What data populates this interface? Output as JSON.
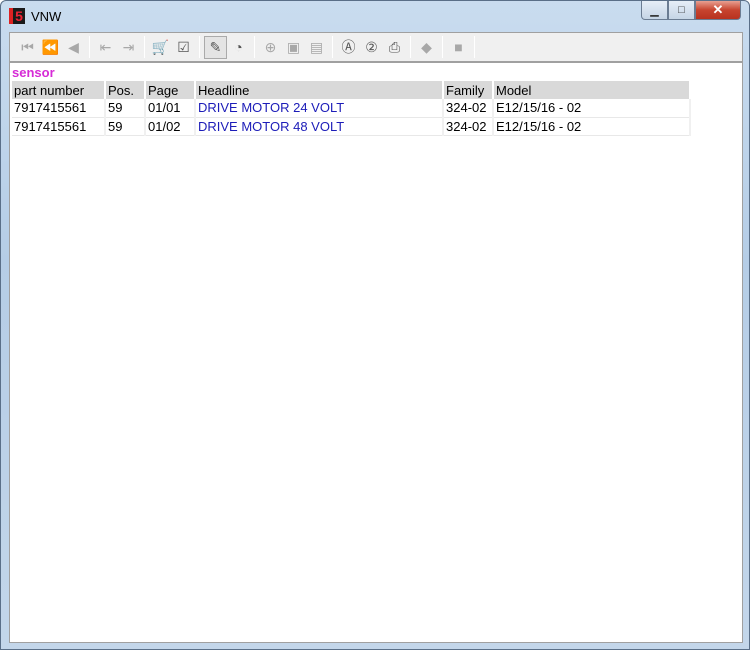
{
  "window": {
    "title": "VNW",
    "minimize": "▁",
    "maximize": "□",
    "close": "✕"
  },
  "toolbar": [
    {
      "name": "first-icon",
      "glyph": "⏮",
      "state": "dis"
    },
    {
      "name": "fast-back-icon",
      "glyph": "⏪",
      "state": "dis"
    },
    {
      "name": "back-icon",
      "glyph": "◀",
      "state": "dis"
    },
    {
      "sep": true
    },
    {
      "name": "prev-doc-icon",
      "glyph": "⇤",
      "state": "dis"
    },
    {
      "name": "next-doc-icon",
      "glyph": "⇥",
      "state": "dis"
    },
    {
      "sep": true
    },
    {
      "name": "cart-icon",
      "glyph": "🛒",
      "state": ""
    },
    {
      "name": "checklist-icon",
      "glyph": "☑",
      "state": ""
    },
    {
      "sep": true
    },
    {
      "name": "tag-icon",
      "glyph": "✎",
      "state": "act"
    },
    {
      "name": "clock-icon",
      "glyph": "◔",
      "state": ""
    },
    {
      "sep": true
    },
    {
      "name": "zoom-in-icon",
      "glyph": "⊕",
      "state": "dis"
    },
    {
      "name": "page-icon",
      "glyph": "▣",
      "state": "dis"
    },
    {
      "name": "page-fold-icon",
      "glyph": "▤",
      "state": "dis"
    },
    {
      "sep": true
    },
    {
      "name": "search-a-icon",
      "glyph": "Ⓐ",
      "state": ""
    },
    {
      "name": "search-2-icon",
      "glyph": "②",
      "state": ""
    },
    {
      "name": "print-icon",
      "glyph": "⎙",
      "state": ""
    },
    {
      "sep": true
    },
    {
      "name": "eraser-icon",
      "glyph": "◆",
      "state": "dis"
    },
    {
      "sep": true
    },
    {
      "name": "stop-icon",
      "glyph": "■",
      "state": "dis"
    },
    {
      "sep": true
    }
  ],
  "heading": "sensor",
  "table": {
    "headers": [
      "part number",
      "Pos.",
      "Page",
      "Headline",
      "Family",
      "Model"
    ],
    "rows": [
      [
        "7917415561",
        "59",
        "01/01",
        "DRIVE MOTOR 24 VOLT",
        "324-02",
        "E12/15/16 - 02"
      ],
      [
        "7917415561",
        "59",
        "01/02",
        "DRIVE MOTOR 48 VOLT",
        "324-02",
        "E12/15/16 - 02"
      ]
    ]
  }
}
